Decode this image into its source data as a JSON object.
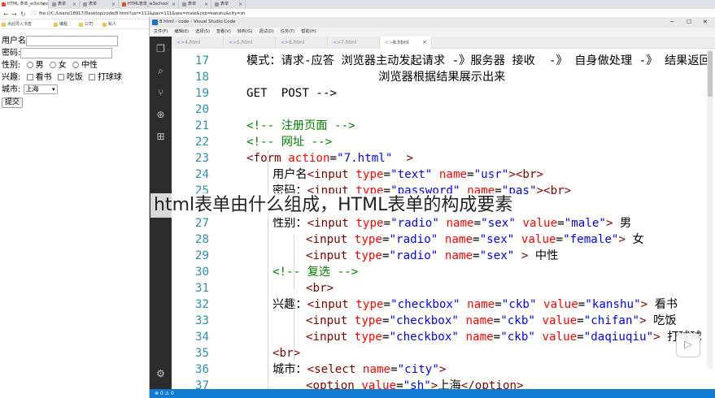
{
  "browser": {
    "tabs": [
      {
        "label": "HTML 表单_w3school",
        "color": "#e44d26"
      },
      {
        "label": "表单",
        "color": "#9a9a9a"
      },
      {
        "label": "表单",
        "color": "#9a9a9a"
      },
      {
        "label": "HTML表单_w3school",
        "color": "#e44d26"
      },
      {
        "label": "表单",
        "color": "#9a9a9a"
      },
      {
        "label": "表单",
        "color": "#9a9a9a"
      }
    ],
    "url": "file:///C:/Users/18917/Desktop/code/8.html?usr=111&pas=111&sex=male&ckb=kanshu&city=sh",
    "bookmarks": [
      "点此导入书签",
      "编程",
      "公司",
      "私人"
    ],
    "form": {
      "username_label": "用户名",
      "password_label": "密码:",
      "gender_label": "性别:",
      "gender_options": [
        "男",
        "女",
        "中性"
      ],
      "hobby_label": "兴趣:",
      "hobby_options": [
        "看书",
        "吃饭",
        "打球球"
      ],
      "city_label": "城市:",
      "city_value": "上海",
      "submit_label": "提交"
    }
  },
  "vscode": {
    "title": "8.html - code - Visual Studio Code",
    "menu": [
      "文件(F)",
      "编辑(E)",
      "选择(S)",
      "查看(V)",
      "转到(G)",
      "调试(D)",
      "任务(T)",
      "帮助(H)"
    ],
    "tabs": [
      {
        "label": "4.html",
        "active": false
      },
      {
        "label": "5.html",
        "active": false
      },
      {
        "label": "6.html",
        "active": false
      },
      {
        "label": "7.html",
        "active": false
      },
      {
        "label": "8.html",
        "active": true
      }
    ],
    "status": "⊗ 0  ⚠ 0",
    "lines": [
      {
        "n": "17",
        "indent": 1,
        "cjk": true,
        "tokens": [
          [
            "kw",
            "模式：请求-应答 浏览器主动发起请求 -》服务器 接收  -》 自身做处理 -》 结果返回"
          ]
        ]
      },
      {
        "n": "18",
        "indent": 1,
        "cjk": true,
        "tokens": [
          [
            "kw",
            "                   浏览器根据结果展示出来"
          ]
        ]
      },
      {
        "n": "19",
        "indent": 1,
        "tokens": [
          [
            "kw",
            "GET  POST -->"
          ]
        ]
      },
      {
        "n": "20",
        "indent": 0,
        "tokens": []
      },
      {
        "n": "21",
        "indent": 1,
        "tokens": [
          [
            "cm",
            "<!-- 注册页面 -->"
          ]
        ]
      },
      {
        "n": "22",
        "indent": 1,
        "tokens": [
          [
            "cm",
            "<!-- 网址 -->"
          ]
        ]
      },
      {
        "n": "23",
        "indent": 1,
        "tokens": [
          [
            "tg",
            "<form "
          ],
          [
            "at",
            "action"
          ],
          [
            "kw",
            "="
          ],
          [
            "st",
            "\"7.html\""
          ],
          [
            "tg",
            "  >"
          ]
        ]
      },
      {
        "n": "24",
        "indent": 2,
        "tokens": [
          [
            "kw",
            "用户名"
          ],
          [
            "tg",
            "<input "
          ],
          [
            "at",
            "type"
          ],
          [
            "kw",
            "="
          ],
          [
            "st",
            "\"text\" "
          ],
          [
            "at",
            "name"
          ],
          [
            "kw",
            "="
          ],
          [
            "st",
            "\"usr\""
          ],
          [
            "tg",
            "><br>"
          ]
        ]
      },
      {
        "n": "25",
        "indent": 2,
        "tokens": [
          [
            "kw",
            "密码："
          ],
          [
            "tg",
            "<input "
          ],
          [
            "at",
            "type"
          ],
          [
            "kw",
            "="
          ],
          [
            "st",
            "\"password\" "
          ],
          [
            "at",
            "name"
          ],
          [
            "kw",
            "="
          ],
          [
            "st",
            "\"pas\""
          ],
          [
            "tg",
            "><br>"
          ]
        ]
      },
      {
        "n": "26",
        "indent": 2,
        "tokens": []
      },
      {
        "n": "27",
        "indent": 2,
        "tokens": [
          [
            "kw",
            "性别："
          ],
          [
            "tg",
            "<input "
          ],
          [
            "at",
            "type"
          ],
          [
            "kw",
            "="
          ],
          [
            "st",
            "\"radio\" "
          ],
          [
            "at",
            "name"
          ],
          [
            "kw",
            "="
          ],
          [
            "st",
            "\"sex\" "
          ],
          [
            "at",
            "value"
          ],
          [
            "kw",
            "="
          ],
          [
            "st",
            "\"male\""
          ],
          [
            "tg",
            ">"
          ],
          [
            "kw",
            " 男"
          ]
        ]
      },
      {
        "n": "28",
        "indent": 3,
        "tokens": [
          [
            "tg",
            "<input "
          ],
          [
            "at",
            "type"
          ],
          [
            "kw",
            "="
          ],
          [
            "st",
            "\"radio\" "
          ],
          [
            "at",
            "name"
          ],
          [
            "kw",
            "="
          ],
          [
            "st",
            "\"sex\" "
          ],
          [
            "at",
            "value"
          ],
          [
            "kw",
            "="
          ],
          [
            "st",
            "\"female\""
          ],
          [
            "tg",
            ">"
          ],
          [
            "kw",
            " 女"
          ]
        ]
      },
      {
        "n": "29",
        "indent": 3,
        "tokens": [
          [
            "tg",
            "<input "
          ],
          [
            "at",
            "type"
          ],
          [
            "kw",
            "="
          ],
          [
            "st",
            "\"radio\" "
          ],
          [
            "at",
            "name"
          ],
          [
            "kw",
            "="
          ],
          [
            "st",
            "\"sex\" "
          ],
          [
            "tg",
            "> "
          ],
          [
            "kw",
            "中性"
          ]
        ]
      },
      {
        "n": "30",
        "indent": 2,
        "tokens": [
          [
            "cm",
            "<!-- 复选 -->"
          ]
        ]
      },
      {
        "n": "31",
        "indent": 3,
        "tokens": [
          [
            "tg",
            "<br>"
          ]
        ]
      },
      {
        "n": "32",
        "indent": 2,
        "tokens": [
          [
            "kw",
            "兴趣："
          ],
          [
            "tg",
            "<input "
          ],
          [
            "at",
            "type"
          ],
          [
            "kw",
            "="
          ],
          [
            "st",
            "\"checkbox\" "
          ],
          [
            "at",
            "name"
          ],
          [
            "kw",
            "="
          ],
          [
            "st",
            "\"ckb\" "
          ],
          [
            "at",
            "value"
          ],
          [
            "kw",
            "="
          ],
          [
            "st",
            "\"kanshu\""
          ],
          [
            "tg",
            ">"
          ],
          [
            "kw",
            " 看书"
          ]
        ]
      },
      {
        "n": "33",
        "indent": 3,
        "tokens": [
          [
            "tg",
            "<input "
          ],
          [
            "at",
            "type"
          ],
          [
            "kw",
            "="
          ],
          [
            "st",
            "\"checkbox\" "
          ],
          [
            "at",
            "name"
          ],
          [
            "kw",
            "="
          ],
          [
            "st",
            "\"ckb\" "
          ],
          [
            "at",
            "value"
          ],
          [
            "kw",
            "="
          ],
          [
            "st",
            "\"chifan\""
          ],
          [
            "tg",
            ">"
          ],
          [
            "kw",
            " 吃饭"
          ]
        ]
      },
      {
        "n": "34",
        "indent": 3,
        "tokens": [
          [
            "tg",
            "<input "
          ],
          [
            "at",
            "type"
          ],
          [
            "kw",
            "="
          ],
          [
            "st",
            "\"checkbox\" "
          ],
          [
            "at",
            "name"
          ],
          [
            "kw",
            "="
          ],
          [
            "st",
            "\"ckb\" "
          ],
          [
            "at",
            "value"
          ],
          [
            "kw",
            "="
          ],
          [
            "st",
            "\"daqiuqiu\""
          ],
          [
            "tg",
            ">"
          ],
          [
            "kw",
            " 打球球"
          ]
        ]
      },
      {
        "n": "35",
        "indent": 2,
        "tokens": [
          [
            "tg",
            "<br>"
          ]
        ]
      },
      {
        "n": "36",
        "indent": 2,
        "tokens": [
          [
            "kw",
            "城市："
          ],
          [
            "tg",
            "<select "
          ],
          [
            "at",
            "name"
          ],
          [
            "kw",
            "="
          ],
          [
            "st",
            "\"city\""
          ],
          [
            "tg",
            ">"
          ]
        ]
      },
      {
        "n": "37",
        "indent": 3,
        "tokens": [
          [
            "tg",
            "<option "
          ],
          [
            "at",
            "value"
          ],
          [
            "kw",
            "="
          ],
          [
            "st",
            "\"sh\""
          ],
          [
            "tg",
            ">"
          ],
          [
            "kw",
            "上海"
          ],
          [
            "tg",
            "</option>"
          ]
        ]
      }
    ]
  },
  "overlay_caption": "html表单由什么组成，HTML表单的构成要素"
}
